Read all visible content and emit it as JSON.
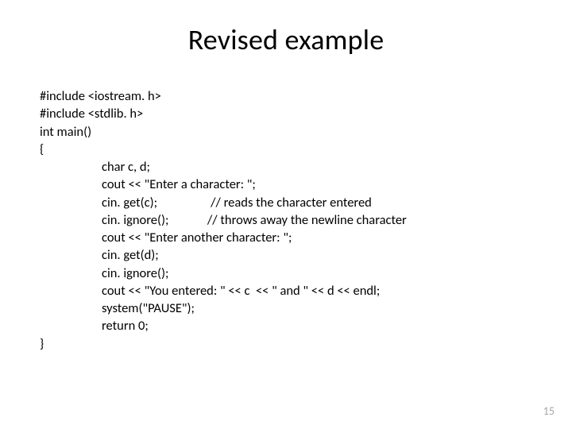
{
  "title": "Revised example",
  "code": {
    "l0": "#include <iostream. h>",
    "l1": "#include <stdlib. h>",
    "l2": "",
    "l3": "int main()",
    "l4": "{",
    "l5": "char c, d;",
    "l6": "cout << \"Enter a character: \";",
    "l7": "cin. get(c);                  // reads the character entered",
    "l8": "cin. ignore();             // throws away the newline character",
    "l9": "cout << \"Enter another character: \";",
    "l10": "cin. get(d);",
    "l11": "cin. ignore();",
    "l12": "cout << \"You entered: \" << c  << \" and \" << d << endl;",
    "l13": "system(\"PAUSE\");",
    "l14": "return 0;",
    "l15": "}"
  },
  "page_number": "15"
}
